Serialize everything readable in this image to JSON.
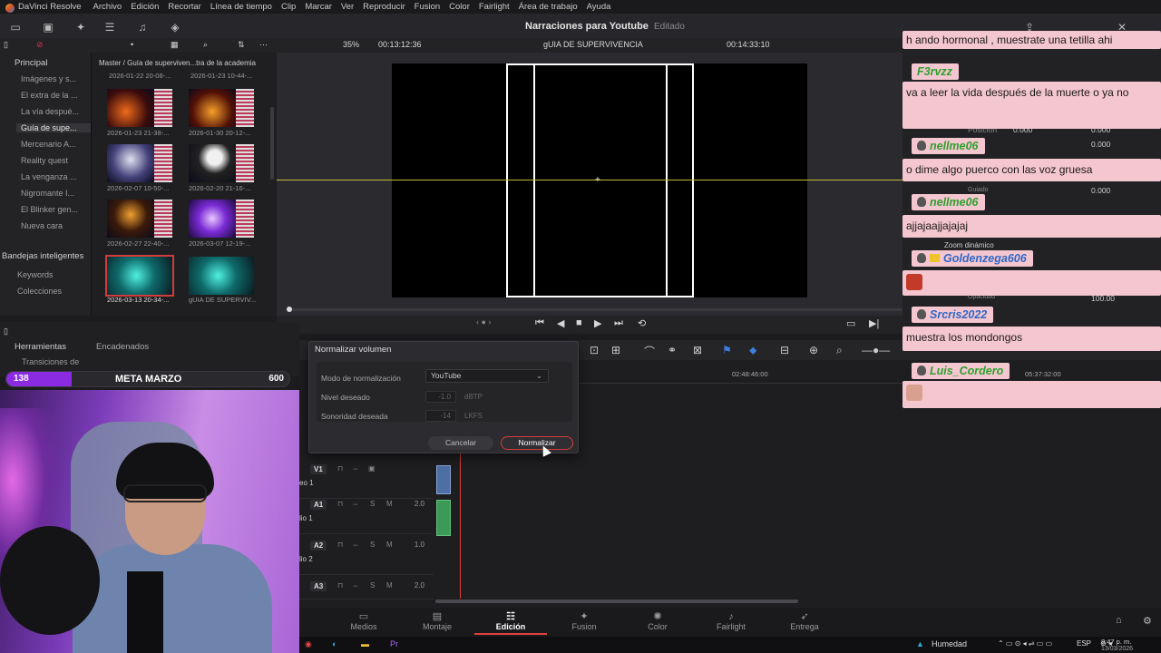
{
  "menubar": {
    "app": "DaVinci Resolve",
    "items": [
      "Archivo",
      "Edición",
      "Recortar",
      "Línea de tiempo",
      "Clip",
      "Marcar",
      "Ver",
      "Reproducir",
      "Fusion",
      "Color",
      "Fairlight",
      "Área de trabajo",
      "Ayuda"
    ]
  },
  "project": {
    "title": "Narraciones para Youtube",
    "status": "Editado"
  },
  "viewer": {
    "zoom": "35%",
    "timecode_left": "00:13:12:36",
    "clip_name": "gUIA DE SUPERVIVENCIA",
    "timecode_right": "00:14:33:10"
  },
  "sidebar": {
    "main_label": "Principal",
    "items": [
      "Imágenes y s...",
      "El extra de la ...",
      "La vía despué...",
      "Guía de supe...",
      "Mercenario A...",
      "Reality quest",
      "La venganza ...",
      "Nigromante I...",
      "El Blinker gen...",
      "Nueva cara"
    ],
    "smart_bins": "Bandejas inteligentes",
    "smart_items": [
      "Keywords",
      "Colecciones"
    ]
  },
  "mediapool": {
    "path": "Master / Guía de superviven...tra de la academia",
    "top_labels": [
      "2026-01-22 20-08-...",
      "2026-01-23 10-44-..."
    ],
    "clips": [
      {
        "label": "2026-01-23 21-38-..."
      },
      {
        "label": "2026-01-30 20-12-..."
      },
      {
        "label": "2026-02-07 10-50-..."
      },
      {
        "label": "2026-02-20 21-16-..."
      },
      {
        "label": "2026-02-27 22-40-..."
      },
      {
        "label": "2026-03-07 12-19-..."
      },
      {
        "label": "2026-03-13 20-34-..."
      },
      {
        "label": "gUIA DE SUPERVIV..."
      }
    ]
  },
  "lower_left": {
    "tools": "Herramientas",
    "transitions": "Transiciones de",
    "linked": "Encadenados"
  },
  "dialog": {
    "title": "Normalizar volumen",
    "mode_label": "Modo de normalización",
    "mode_value": "YouTube",
    "level_label": "Nivel deseado",
    "level_value": "-1.0",
    "level_unit": "dBTP",
    "loudness_label": "Sonoridad deseada",
    "loudness_value": "-14",
    "loudness_unit": "LKFS",
    "cancel": "Cancelar",
    "normalize": "Normalizar"
  },
  "timeline": {
    "ruler_labels": [
      "02:48:46:00",
      "05:37:32:00"
    ],
    "tracks": [
      {
        "id": "V1",
        "label": "eo 1",
        "vol": ""
      },
      {
        "id": "A1",
        "label": "lio 1",
        "vol": "2.0"
      },
      {
        "id": "A2",
        "label": "lio 2",
        "vol": "1.0"
      },
      {
        "id": "A3",
        "label": "",
        "vol": "2.0"
      }
    ]
  },
  "pagetabs": {
    "items": [
      {
        "icon": "media-icon",
        "label": "Medios"
      },
      {
        "icon": "cut-icon",
        "label": "Montaje"
      },
      {
        "icon": "edit-icon",
        "label": "Edición"
      },
      {
        "icon": "fusion-icon",
        "label": "Fusion"
      },
      {
        "icon": "color-icon",
        "label": "Color"
      },
      {
        "icon": "fairlight-icon",
        "label": "Fairlight"
      },
      {
        "icon": "deliver-icon",
        "label": "Entrega"
      }
    ],
    "active": "Edición"
  },
  "inspector": {
    "posicion": "Posición",
    "val1": "0.000",
    "val2": "0.000",
    "val3": "0.000",
    "guiado": "Guiado",
    "zoom_dyn": "Zoom dinámico",
    "opacidad": "Opacidad",
    "opac_val": "100.00"
  },
  "taskbar": {
    "weather": "Humedad",
    "lang": "ESP",
    "time": "8:47 p. m.",
    "date": "13/03/2026"
  },
  "goal": {
    "current": "138",
    "name": "META MARZO",
    "target": "600",
    "progress": 0.23
  },
  "chat": [
    {
      "user": "",
      "msg": "h ando hormonal , muestrate una tetilla ahi",
      "style": "green"
    },
    {
      "user": "F3rvzz",
      "msg": "va a leer la vida después de la muerte o ya no",
      "style": "green"
    },
    {
      "user": "nellme06",
      "msg": "o dime algo puerco con las voz gruesa",
      "style": "green"
    },
    {
      "user": "nellme06",
      "msg": "ajjajaajjajajaj",
      "style": "green"
    },
    {
      "user": "Goldenzega606",
      "msg": "",
      "style": "blue"
    },
    {
      "user": "Srcris2022",
      "msg": "muestra los mondongos",
      "style": "blue"
    },
    {
      "user": "Luis_Cordero",
      "msg": "",
      "style": "green"
    }
  ],
  "colors": {
    "accent": "#d33c3c",
    "chat_bg": "#f4c6cf",
    "goal_fill": "#8a2be2"
  }
}
